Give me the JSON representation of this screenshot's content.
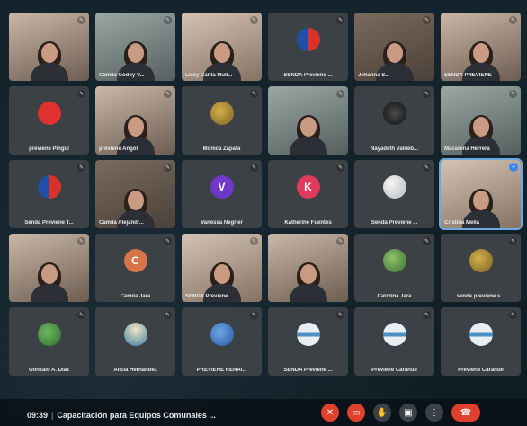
{
  "meeting": {
    "time": "09:39",
    "separator": "|",
    "title": "Capacitación para Equipos Comunales ..."
  },
  "participants": [
    {
      "name": "",
      "kind": "video",
      "variant": "v2"
    },
    {
      "name": "Camila Godoy V...",
      "kind": "video",
      "variant": "v3"
    },
    {
      "name": "Lissy Canta Mull...",
      "kind": "video",
      "variant": "v4"
    },
    {
      "name": "SENDA Previene ...",
      "kind": "avatar",
      "variant": "flag",
      "letter": ""
    },
    {
      "name": "Johanna S...",
      "kind": "video",
      "variant": ""
    },
    {
      "name": "SENDA PREVIENE",
      "kind": "video",
      "variant": "v2"
    },
    {
      "name": "previene Pingul",
      "kind": "avatar",
      "variant": "red",
      "letter": ""
    },
    {
      "name": "previene Angol",
      "kind": "video",
      "variant": "v2"
    },
    {
      "name": "Monica Zapata",
      "kind": "avatar",
      "variant": "photo",
      "letter": ""
    },
    {
      "name": "",
      "kind": "video",
      "variant": "v3"
    },
    {
      "name": "Nayadeth Valdeb...",
      "kind": "avatar",
      "variant": "dark",
      "letter": ""
    },
    {
      "name": "Macarena Herrera",
      "kind": "video",
      "variant": "v3"
    },
    {
      "name": "Senda Previene T...",
      "kind": "avatar",
      "variant": "flag",
      "letter": ""
    },
    {
      "name": "Camila Alejandr...",
      "kind": "video",
      "variant": ""
    },
    {
      "name": "Vanessa Negrier",
      "kind": "avatar",
      "variant": "purple",
      "letter": "V"
    },
    {
      "name": "Katherine Fuentes",
      "kind": "avatar",
      "variant": "pink",
      "letter": "K"
    },
    {
      "name": "Senda Previene ...",
      "kind": "avatar",
      "variant": "logo",
      "letter": ""
    },
    {
      "name": "Cristina Mella",
      "kind": "video",
      "variant": "v4",
      "active": true
    },
    {
      "name": "",
      "kind": "video",
      "variant": "v2"
    },
    {
      "name": "Camila Jara",
      "kind": "avatar",
      "variant": "orange",
      "letter": "C"
    },
    {
      "name": "SENDA Previene",
      "kind": "video",
      "variant": "v4"
    },
    {
      "name": "",
      "kind": "video",
      "variant": "v2"
    },
    {
      "name": "Carolina Jara",
      "kind": "avatar",
      "variant": "globe",
      "letter": ""
    },
    {
      "name": "senda previene s...",
      "kind": "avatar",
      "variant": "photo",
      "letter": ""
    },
    {
      "name": "Gonzalo A. Diaz",
      "kind": "avatar",
      "variant": "tree",
      "letter": ""
    },
    {
      "name": "Alicia Hernandez",
      "kind": "avatar",
      "variant": "sea",
      "letter": ""
    },
    {
      "name": "PREVIENE RENAI...",
      "kind": "avatar",
      "variant": "blue",
      "letter": ""
    },
    {
      "name": "SENDA Previene ...",
      "kind": "avatar",
      "variant": "band",
      "letter": ""
    },
    {
      "name": "Previene Carahue",
      "kind": "avatar",
      "variant": "band",
      "letter": ""
    },
    {
      "name": "Previene Carahue",
      "kind": "avatar",
      "variant": "band",
      "letter": ""
    }
  ],
  "controls": [
    {
      "name": "mic-off-button",
      "icon": "mic-off-icon",
      "glyph": "✕",
      "style": "red"
    },
    {
      "name": "camera-off-button",
      "icon": "camera-off-icon",
      "glyph": "▭",
      "style": "red"
    },
    {
      "name": "raise-hand-button",
      "icon": "hand-icon",
      "glyph": "✋",
      "style": "gray"
    },
    {
      "name": "present-button",
      "icon": "present-icon",
      "glyph": "▣",
      "style": "gray"
    },
    {
      "name": "more-options-button",
      "icon": "more-vert-icon",
      "glyph": "⋮",
      "style": "gray"
    },
    {
      "name": "end-call-button",
      "icon": "phone-hangup-icon",
      "glyph": "☎",
      "style": "end"
    }
  ]
}
